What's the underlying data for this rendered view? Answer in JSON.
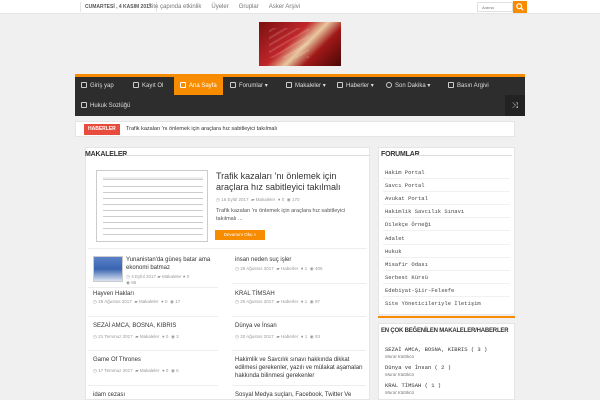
{
  "topbar": {
    "date": "CUMARTESİ , 4 KASIM 2017",
    "links": [
      "Site çapında etkinlik",
      "Üyeler",
      "Gruplar",
      "Asker Arşivi"
    ],
    "search_placeholder": "Arama",
    "search_icon": "search-icon"
  },
  "nav": {
    "row1": [
      {
        "label": "Giriş yap",
        "icon": "key-icon"
      },
      {
        "label": "Kayıt Ol",
        "icon": "user-plus-icon"
      },
      {
        "label": "Ana Sayfa",
        "icon": "home-icon"
      },
      {
        "label": "Forumlar",
        "icon": "forum-icon"
      },
      {
        "label": "Makaleler",
        "icon": "document-icon"
      },
      {
        "label": "Haberler",
        "icon": "news-icon"
      },
      {
        "label": "Son Dakika",
        "icon": "clock-icon"
      },
      {
        "label": "Basın Argivi",
        "icon": "archive-icon"
      }
    ],
    "row2": [
      {
        "label": "Hukuk Sozlüğü",
        "icon": "book-icon"
      }
    ],
    "shuffle_icon": "shuffle-icon"
  },
  "breaking": {
    "label": "HABERLER",
    "text": "Trafik kazaları 'nı önlemek için araçlara hız sabitleyici takılmalı"
  },
  "main": {
    "title": "MAKALELER",
    "featured": {
      "title": "Trafik kazaları 'nı önlemek için araçlara hız sabitleyici takılmalı",
      "date": "16 Eylül 2017",
      "category": "Makaleler",
      "comments": "0",
      "views": "170",
      "excerpt": "Trafik kazaları 'nı önlemek için araçlara hız sabitleyici takılmalı ...",
      "more": "Devamını Oku »"
    },
    "posts_left": [
      {
        "title": "Yunanistan'da güneş batar ama ekonomi batmaz",
        "date": "4 Eylül 2017",
        "category": "Makaleler",
        "comments": "0",
        "views": "86"
      },
      {
        "title": "Hayven Hakları",
        "date": "25 Ağustos 2017",
        "category": "Makaleler",
        "comments": "0",
        "views": "17"
      },
      {
        "title": "SEZAİ AMCA, BOSNA, KIBRIS",
        "date": "21 Temmuz 2017",
        "category": "Makaleler",
        "comments": "0",
        "views": "3"
      },
      {
        "title": "Game Of Thrones",
        "date": "17 Temmuz 2017",
        "category": "Makaleler",
        "comments": "0",
        "views": "5"
      },
      {
        "title": "idam cezası",
        "date": "",
        "category": "",
        "comments": "",
        "views": ""
      }
    ],
    "posts_right": [
      {
        "title": "insan neden suç işler",
        "date": "26 Ağustos 2017",
        "category": "Haberler",
        "comments": "1",
        "views": "406"
      },
      {
        "title": "KRAL TİMSAH",
        "date": "25 Ağustos 2017",
        "category": "Haberler",
        "comments": "1",
        "views": "97"
      },
      {
        "title": "Dünya ve İnsan",
        "date": "20 Ağustos 2017",
        "category": "Haberler",
        "comments": "1",
        "views": "93"
      },
      {
        "title": "Hakimlik ve Savcılık sınavı hakkında dikkat edilmesi gerekenler, yazılı ve mülakat aşamaları hakkında bilinmesi gerekenler",
        "date": "",
        "category": "",
        "comments": "",
        "views": ""
      },
      {
        "title": "Sosyal Medya suçları, Facebook, Twitter Ve",
        "date": "",
        "category": "",
        "comments": "",
        "views": ""
      }
    ]
  },
  "sidebar": {
    "forum_title": "FORUMLAR",
    "forum_links": [
      "Hakim Portal",
      "Savcı Portal",
      "Avukat Portal",
      "Hakimlik Savcılık Sınavı",
      "Dilekçe Örneği",
      "Adalet",
      "Hukuk",
      "Misafir Odası",
      "Serbest Kürsü",
      "Edebiyat-Şiir-Felsefe",
      "Site Yöneticileriyle İletişim"
    ],
    "liked_title": "EN ÇOK BEĞENİLEN MAKALELER/HABERLER",
    "liked": [
      {
        "title": "SEZAİ AMCA, BOSNA, KIBRIS ( 3 )",
        "author": "Murat Kütükcü"
      },
      {
        "title": "Dünya ve İnsan ( 2 )",
        "author": "Murat Kütükcü"
      },
      {
        "title": "KRAL TİMSAH ( 1 )",
        "author": "Murat Kütükcü"
      }
    ]
  },
  "colors": {
    "accent": "#f88c00",
    "nav_bg": "#2d2d2d",
    "breaking": "#e74c3c"
  }
}
